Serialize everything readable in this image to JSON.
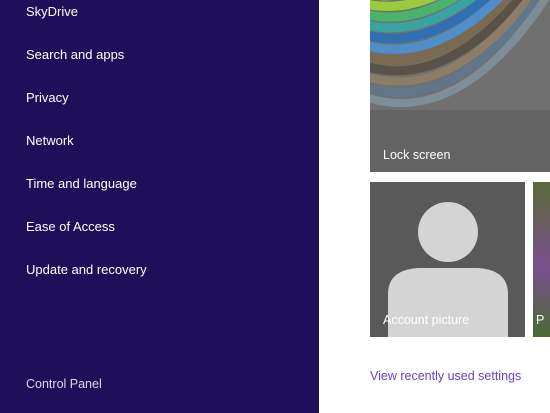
{
  "sidebar": {
    "items": [
      {
        "label": "SkyDrive"
      },
      {
        "label": "Search and apps"
      },
      {
        "label": "Privacy"
      },
      {
        "label": "Network"
      },
      {
        "label": "Time and language"
      },
      {
        "label": "Ease of Access"
      },
      {
        "label": "Update and recovery"
      }
    ],
    "control_panel_label": "Control Panel"
  },
  "tiles": {
    "lock_screen_label": "Lock screen",
    "account_picture_label": "Account picture",
    "photos_label_partial": "P"
  },
  "recent_link_label": "View recently used settings",
  "colors": {
    "sidebar_bg": "#1f0f5a",
    "link": "#6b3fd0",
    "tile_gray": "#595959"
  }
}
